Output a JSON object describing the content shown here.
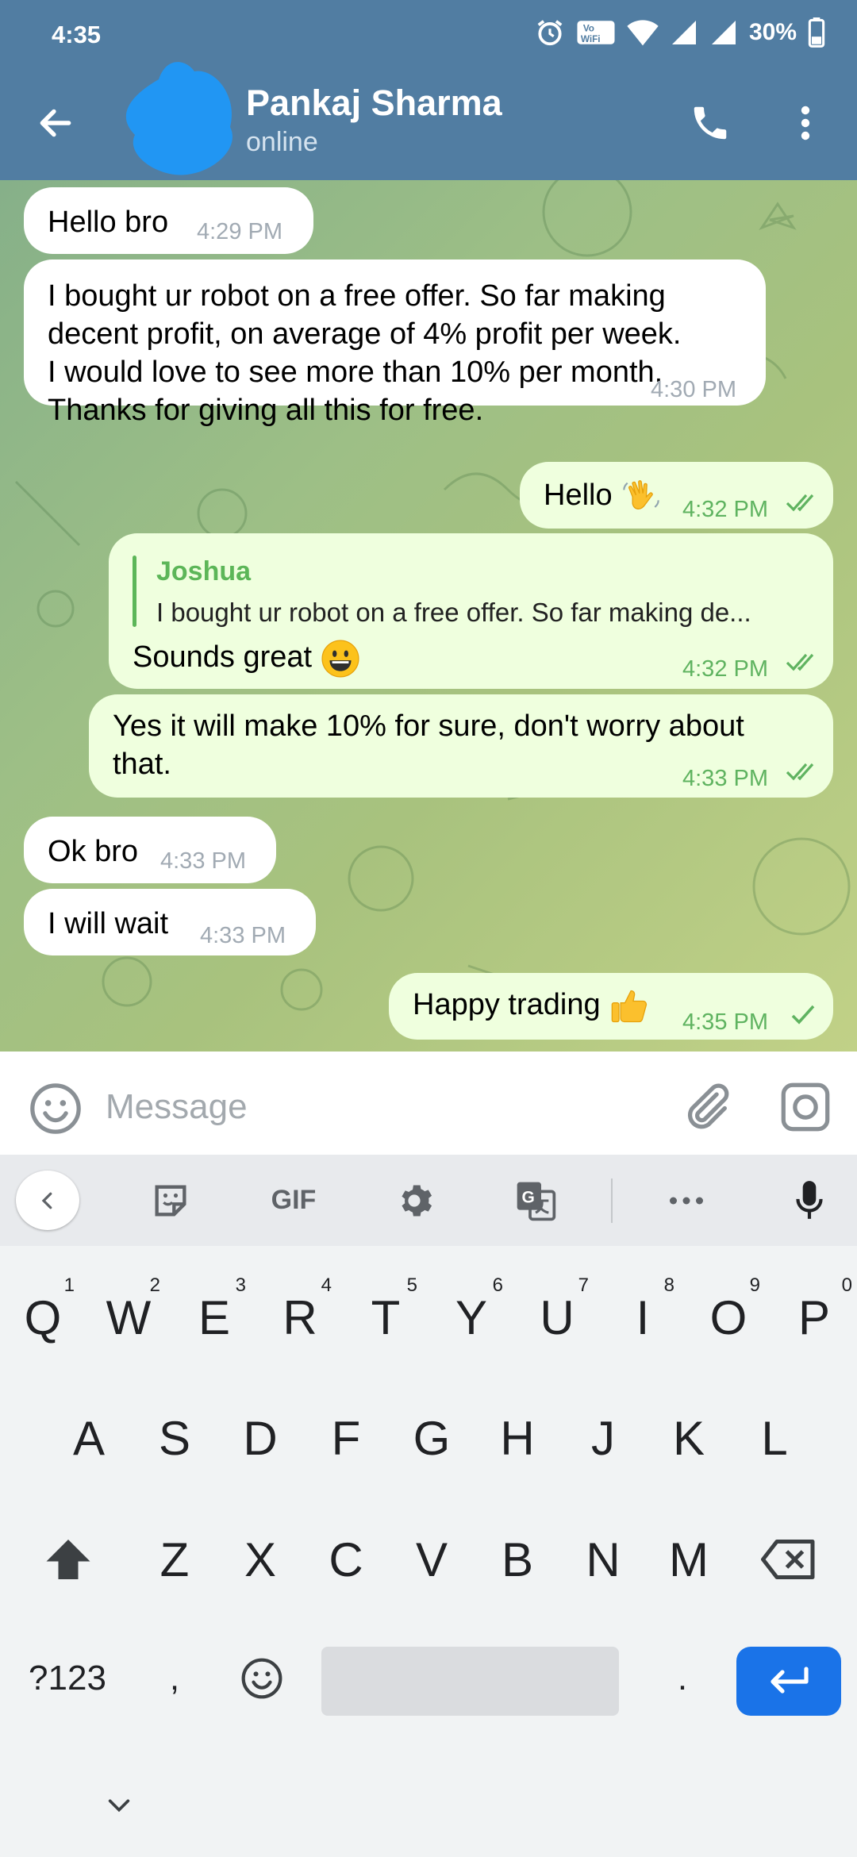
{
  "status_bar": {
    "time": "4:35",
    "battery": "30%",
    "icons": [
      "alarm-icon",
      "vowifi-icon",
      "wifi-icon",
      "signal-icon",
      "signal-icon",
      "battery-icon"
    ]
  },
  "header": {
    "contact_name": "Pankaj Sharma",
    "contact_status": "online",
    "accent_color": "#517da2"
  },
  "messages": [
    {
      "direction": "in",
      "text": "Hello bro",
      "time": "4:29 PM"
    },
    {
      "direction": "in",
      "lines": [
        "I bought ur robot on a free offer. So far making",
        "decent profit, on average of 4% profit per week.",
        "I would love to see more than 10% per month.",
        "Thanks for giving all this for free."
      ],
      "time": "4:30 PM"
    },
    {
      "direction": "out",
      "text": "Hello",
      "emoji": "waving-hand",
      "time": "4:32 PM",
      "status": "read"
    },
    {
      "direction": "out",
      "reply_to": {
        "name": "Joshua",
        "text": "I bought ur robot on a free offer. So far making de..."
      },
      "text": "Sounds great",
      "emoji": "grinning-face",
      "time": "4:32 PM",
      "status": "read"
    },
    {
      "direction": "out",
      "lines": [
        "Yes it will make 10% for sure, don't worry about",
        "that."
      ],
      "time": "4:33 PM",
      "status": "read"
    },
    {
      "direction": "in",
      "text": "Ok bro",
      "time": "4:33 PM"
    },
    {
      "direction": "in",
      "text": "I will wait",
      "time": "4:33 PM"
    },
    {
      "direction": "out",
      "text": "Happy trading",
      "emoji": "thumbs-up",
      "time": "4:35 PM",
      "status": "sent"
    }
  ],
  "composer": {
    "placeholder": "Message"
  },
  "keyboard": {
    "toolbar": {
      "gif_label": "GIF"
    },
    "row1": [
      {
        "key": "Q",
        "hint": "1"
      },
      {
        "key": "W",
        "hint": "2"
      },
      {
        "key": "E",
        "hint": "3"
      },
      {
        "key": "R",
        "hint": "4"
      },
      {
        "key": "T",
        "hint": "5"
      },
      {
        "key": "Y",
        "hint": "6"
      },
      {
        "key": "U",
        "hint": "7"
      },
      {
        "key": "I",
        "hint": "8"
      },
      {
        "key": "O",
        "hint": "9"
      },
      {
        "key": "P",
        "hint": "0"
      }
    ],
    "row2": [
      "A",
      "S",
      "D",
      "F",
      "G",
      "H",
      "J",
      "K",
      "L"
    ],
    "row3": [
      "Z",
      "X",
      "C",
      "V",
      "B",
      "N",
      "M"
    ],
    "bottom": {
      "symbols_label": "?123",
      "comma": ",",
      "period": "."
    }
  }
}
